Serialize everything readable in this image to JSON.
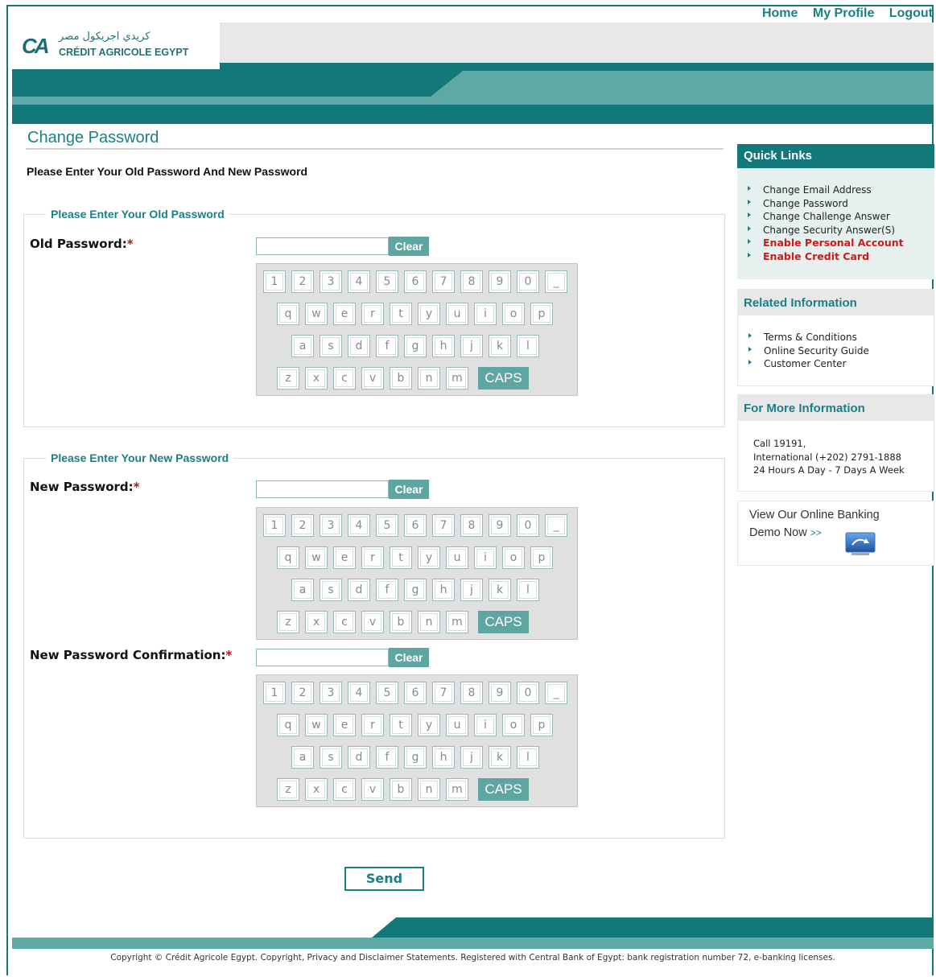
{
  "nav": {
    "home": "Home",
    "profile": "My Profile",
    "logout": "Logout"
  },
  "logo": {
    "arabic": "كريدي اجريكول مصر",
    "english": "CRÉDIT AGRICOLE EGYPT",
    "mark": "CA"
  },
  "page": {
    "title": "Change Password",
    "subtitle": "Please Enter Your Old Password And New Password"
  },
  "old_section": {
    "legend": "Please Enter Your Old Password",
    "label": "Old Password:",
    "required": "*",
    "clear": "Clear"
  },
  "new_section": {
    "legend": "Please Enter Your New Password",
    "new_label": "New Password:",
    "confirm_label": "New Password Confirmation:",
    "required": "*",
    "clear": "Clear"
  },
  "keyboard": {
    "row1": [
      "1",
      "2",
      "3",
      "4",
      "5",
      "6",
      "7",
      "8",
      "9",
      "0",
      "_"
    ],
    "row2": [
      "q",
      "w",
      "e",
      "r",
      "t",
      "y",
      "u",
      "i",
      "o",
      "p"
    ],
    "row3": [
      "a",
      "s",
      "d",
      "f",
      "g",
      "h",
      "j",
      "k",
      "l"
    ],
    "row4": [
      "z",
      "x",
      "c",
      "v",
      "b",
      "n",
      "m"
    ],
    "caps": "CAPS"
  },
  "send_label": "Send",
  "sidebar": {
    "quick_links": {
      "title": "Quick Links",
      "items": [
        "Change Email Address",
        "Change Password",
        "Change Challenge Answer",
        "Change Security Answer(S)"
      ],
      "highlight_items": [
        "Enable Personal Account",
        "Enable Credit Card"
      ]
    },
    "related": {
      "title": "Related Information",
      "items": [
        "Terms & Conditions",
        "Online Security Guide",
        "Customer Center"
      ]
    },
    "more_info": {
      "title": "For More Information",
      "lines": [
        "Call 19191,",
        "International (+202) 2791-1888",
        "24 Hours A Day - 7 Days A Week"
      ]
    },
    "demo": {
      "line1": "View Our Online Banking",
      "line2": "Demo Now",
      "arrow": ">>"
    }
  },
  "footer": {
    "copyright": "Copyright © Crédit Agricole Egypt. Copyright, Privacy and Disclaimer Statements. Registered with Central Bank of Egypt: bank registration number 72, e-banking licenses."
  },
  "colors": {
    "primary": "#13787a",
    "light": "#5ea8a5",
    "accent_red": "#d01a1a"
  }
}
